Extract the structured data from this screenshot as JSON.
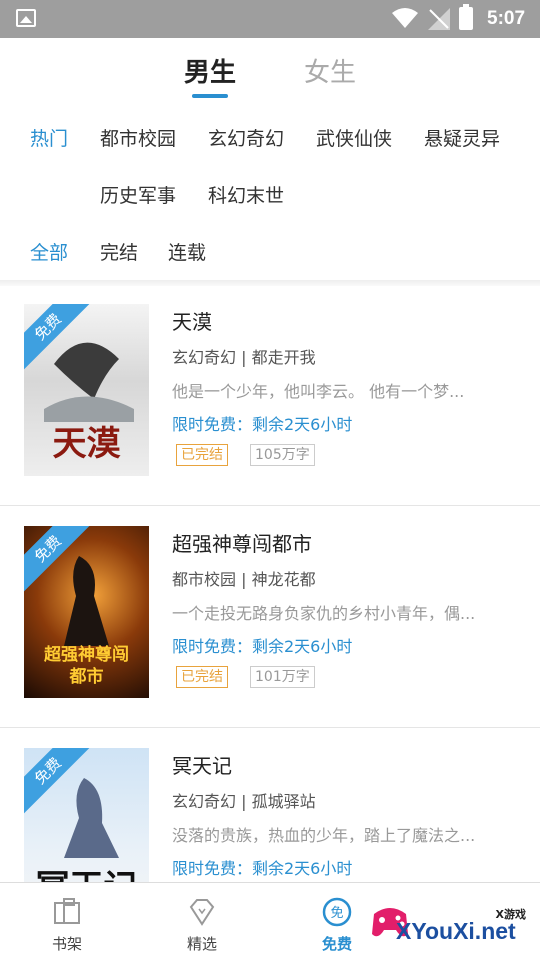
{
  "status_bar": {
    "time": "5:07"
  },
  "gender_tabs": [
    {
      "label": "男生",
      "active": true
    },
    {
      "label": "女生",
      "active": false
    }
  ],
  "categories": [
    "热门",
    "都市校园",
    "玄幻奇幻",
    "武侠仙侠",
    "悬疑灵异",
    "历史军事",
    "科幻末世"
  ],
  "status_filters": [
    "全部",
    "完结",
    "连载"
  ],
  "books": [
    {
      "badge": "免费",
      "cover_title": "天漠",
      "title": "天漠",
      "meta": "玄幻奇幻 | 都走开我",
      "desc": "他是一个少年，他叫李云。 他有一个梦...",
      "free_text": "限时免费：剩余2天6小时",
      "status_tag": "已完结",
      "words_tag": "105万字"
    },
    {
      "badge": "免费",
      "cover_title": "超强神尊闯都市",
      "title": "超强神尊闯都市",
      "meta": "都市校园 | 神龙花都",
      "desc": "一个走投无路身负家仇的乡村小青年，偶...",
      "free_text": "限时免费：剩余2天6小时",
      "status_tag": "已完结",
      "words_tag": "101万字"
    },
    {
      "badge": "免费",
      "cover_title": "冥王记",
      "title": "冥天记",
      "meta": "玄幻奇幻 | 孤城驿站",
      "desc": "没落的贵族，热血的少年，踏上了魔法之...",
      "free_text": "限时免费：剩余2天6小时"
    }
  ],
  "bottom_nav": [
    {
      "label": "书架",
      "icon": "bookshelf-icon",
      "active": false
    },
    {
      "label": "精选",
      "icon": "diamond-icon",
      "active": false
    },
    {
      "label": "免费",
      "icon": "free-icon",
      "active": true,
      "icon_text": "免"
    }
  ],
  "watermark": {
    "top": "X游戏",
    "text": "XYouXi.net"
  },
  "colors": {
    "accent": "#2a8fd0",
    "badge": "#3ea0e0",
    "done_tag": "#e8a33d",
    "status_bar": "#9e9e9e"
  }
}
